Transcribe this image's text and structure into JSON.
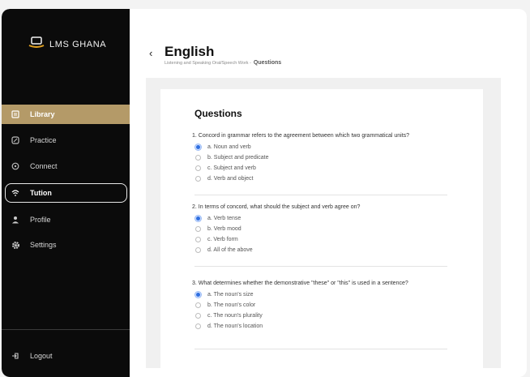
{
  "brand": {
    "name": "LMS GHANA"
  },
  "sidebar": {
    "items": [
      {
        "label": "Library",
        "icon": "library-icon"
      },
      {
        "label": "Practice",
        "icon": "practice-icon"
      },
      {
        "label": "Connect",
        "icon": "connect-icon"
      },
      {
        "label": "Tution",
        "icon": "tution-icon"
      },
      {
        "label": "Profile",
        "icon": "profile-icon"
      },
      {
        "label": "Settings",
        "icon": "gear-icon"
      }
    ],
    "logout": "Logout",
    "active": "Library"
  },
  "header": {
    "back": "‹",
    "title": "English",
    "breadcrumb": "Listening and Speaking Oral/Speech Work -",
    "breadcrumb_current": "Questions"
  },
  "content": {
    "title": "Questions",
    "questions": [
      {
        "text": "1. Concord in grammar refers to the agreement between which two grammatical units?",
        "options": [
          "a. Noun and verb",
          "b. Subject and predicate",
          "c. Subject and verb",
          "d. Verb and object"
        ],
        "selected": 0
      },
      {
        "text": "2. In terms of concord, what should the subject and verb agree on?",
        "options": [
          "a. Verb tense",
          "b. Verb mood",
          "c. Verb form",
          "d. All of the above"
        ],
        "selected": 0
      },
      {
        "text": "3. What determines whether the demonstrative \"these\" or \"this\" is used in a sentence?",
        "options": [
          "a. The noun's size",
          "b. The noun's color",
          "c. The noun's plurality",
          "d. The noun's location"
        ],
        "selected": 0
      }
    ]
  },
  "colors": {
    "sidebar_bg": "#0b0b0b",
    "active_bg": "#b49a68",
    "radio_selected": "#2f6fe0"
  }
}
